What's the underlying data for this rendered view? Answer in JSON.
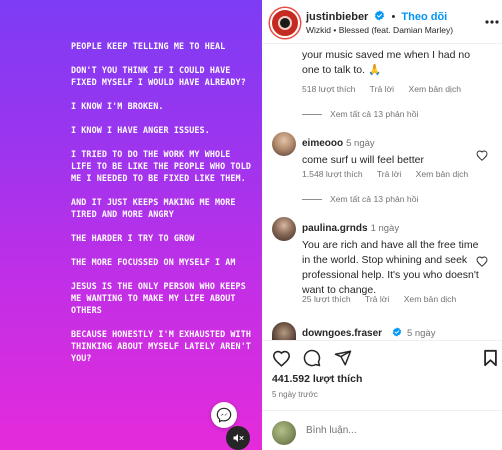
{
  "post_text": {
    "lines": [
      "PEOPLE KEEP TELLING ME TO HEAL",
      "DON'T YOU THINK IF I COULD HAVE FIXED MYSELF I WOULD HAVE ALREADY?",
      "I KNOW I'M BROKEN.",
      "I KNOW I HAVE ANGER ISSUES.",
      "I TRIED TO DO THE WORK MY WHOLE LIFE TO BE LIKE THE PEOPLE WHO TOLD ME I NEEDED TO BE FIXED LIKE THEM.",
      "AND IT JUST KEEPS MAKING ME MORE TIRED AND MORE ANGRY",
      "THE HARDER I TRY TO GROW",
      "THE MORE FOCUSSED ON MYSELF I AM",
      "JESUS IS THE ONLY PERSON WHO KEEPS ME WANTING TO MAKE MY LIFE ABOUT OTHERS",
      "BECAUSE HONESTLY I'M EXHAUSTED  WITH THINKING ABOUT MYSELF LATELY AREN'T YOU?"
    ]
  },
  "header": {
    "username": "justinbieber",
    "follow_label": "Theo dõi",
    "dot": "•",
    "music": "Wizkid • Blessed (feat. Damian Marley)"
  },
  "comments": [
    {
      "text": "your music saved me when I had no one to talk to. 🙏",
      "likes": "518 lượt thích",
      "reply": "Trả lời",
      "translate": "Xem bản dịch",
      "view_replies": "Xem tất cả 13 phản hồi"
    },
    {
      "username": "eimeooo",
      "time": "5 ngày",
      "text": "come surf u will feel better",
      "likes": "1.548 lượt thích",
      "reply": "Trả lời",
      "translate": "Xem bản dịch",
      "view_replies": "Xem tất cả 13 phản hồi"
    },
    {
      "username": "paulina.grnds",
      "time": "1 ngày",
      "text": "You are rich and have all the free time in the world. Stop whining and seek professional help. It's you who doesn't want to change.",
      "likes": "25 lượt thích",
      "reply": "Trả lời",
      "translate": "Xem bản dịch"
    },
    {
      "username": "downgoes.fraser",
      "time": "5 ngày"
    }
  ],
  "post_footer": {
    "likes": "441.592 lượt thích",
    "date": "5 ngày trước",
    "comment_placeholder": "Bình luận..."
  },
  "colors": {
    "accent": "#0095f6",
    "gradient_top": "#7d3cf4",
    "gradient_bottom": "#e52bdb",
    "verified": "#0095f6"
  },
  "icons": [
    "verified-icon",
    "more-icon",
    "heart-icon",
    "comment-icon",
    "share-icon",
    "bookmark-icon",
    "mute-icon",
    "messenger-icon"
  ]
}
